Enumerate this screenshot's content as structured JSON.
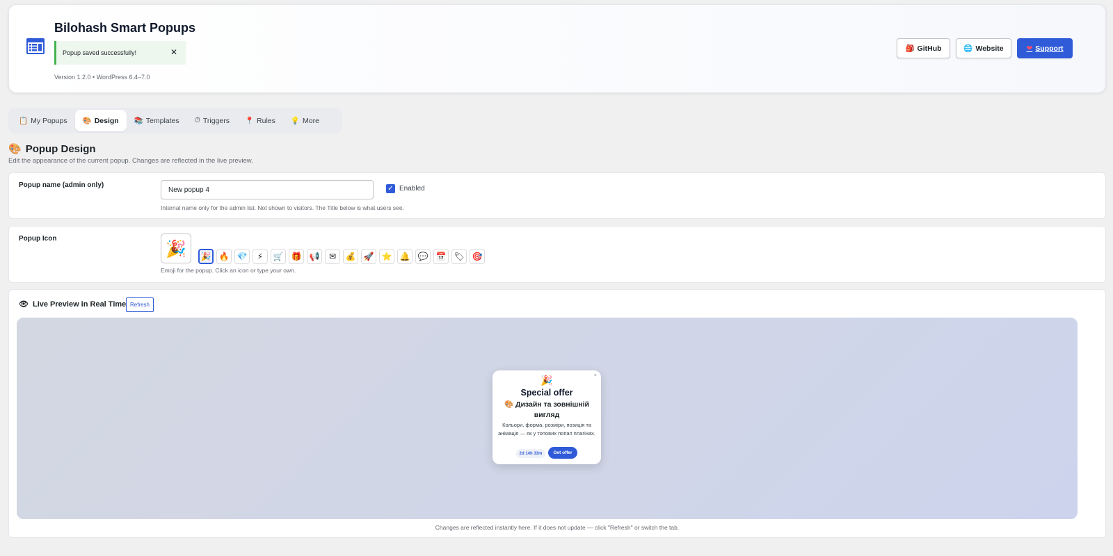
{
  "header": {
    "title": "Bilohash Smart Popups",
    "notice": "Popup saved successfully!",
    "notice_close": "✕",
    "version": "Version 1.2.0 • WordPress 6.4–7.0",
    "buttons": {
      "github": {
        "icon": "🎒",
        "label": "GitHub"
      },
      "website": {
        "icon": "🌐",
        "label": "Website"
      },
      "support": {
        "icon": "❤",
        "label": "Support"
      }
    }
  },
  "tabs": [
    {
      "icon": "📋",
      "label": "My Popups"
    },
    {
      "icon": "🎨",
      "label": "Design"
    },
    {
      "icon": "📚",
      "label": "Templates"
    },
    {
      "icon": "⏱",
      "label": "Triggers"
    },
    {
      "icon": "📍",
      "label": "Rules"
    },
    {
      "icon": "💡",
      "label": "More"
    }
  ],
  "active_tab": "Design",
  "section": {
    "icon": "🎨",
    "title": "Popup Design",
    "subtitle": "Edit the appearance of the current popup. Changes are reflected in the live preview."
  },
  "name_field": {
    "label": "Popup name (admin only)",
    "value": "New popup 4",
    "enabled_label": "Enabled",
    "enabled": true,
    "help": "Internal name only for the admin list. Not shown to visitors. The Title below is what users see."
  },
  "icon_field": {
    "label": "Popup Icon",
    "current": "🎉",
    "options": [
      "🎉",
      "🔥",
      "💎",
      "⚡",
      "🛒",
      "🎁",
      "📢",
      "✉",
      "💰",
      "🚀",
      "⭐",
      "🔔",
      "💬",
      "📅",
      "🏷",
      "🎯"
    ],
    "selected_index": 0,
    "help": "Emoji for the popup. Click an icon or type your own."
  },
  "preview": {
    "icon": "👁",
    "title": "Live Preview in Real Time",
    "refresh_label": "Refresh",
    "note": "Changes are reflected instantly here. If it does not update — click \"Refresh\" or switch the tab.",
    "popup": {
      "close": "×",
      "icon": "🎉",
      "title": "Special offer",
      "subtitle": "🎨 Дизайн та зовнішній вигляд",
      "text": "Кольори, форма, розміри, позиція та анімація — як у топових попап плагінах.",
      "timer": "2d 14h 33m",
      "cta": "Get offer"
    }
  },
  "colors": {
    "accent": "#2f5bd8",
    "notice_border": "#46b450",
    "notice_bg": "#edf7ee",
    "page_bg": "#f0f0f1"
  }
}
